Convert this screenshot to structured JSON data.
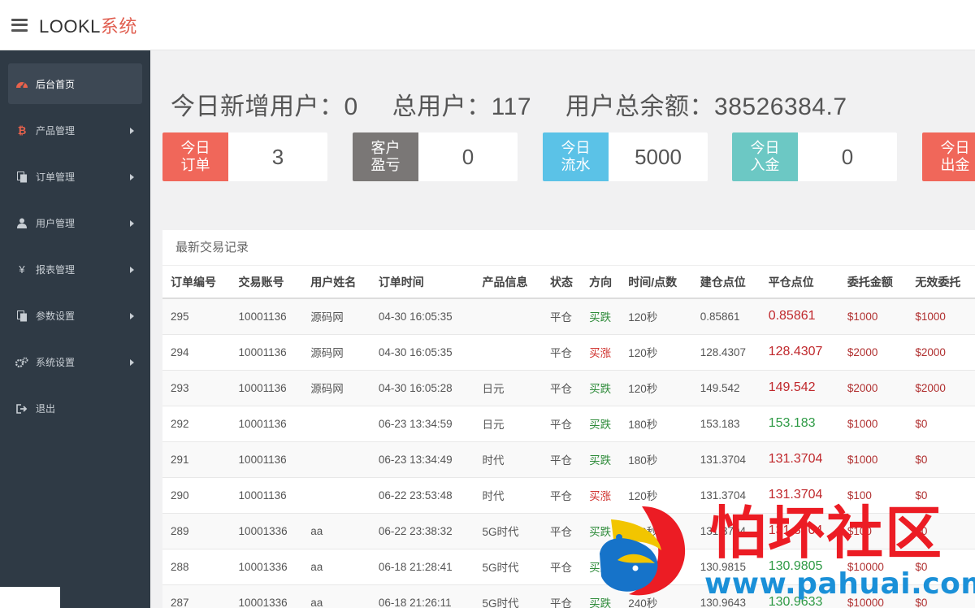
{
  "header": {
    "brand_prefix": "LOOKL",
    "brand_suffix": "系统"
  },
  "sidebar": {
    "items": [
      {
        "label": "后台首页",
        "icon": "dashboard-icon"
      },
      {
        "label": "产品管理",
        "icon": "bitcoin-icon"
      },
      {
        "label": "订单管理",
        "icon": "copy-icon"
      },
      {
        "label": "用户管理",
        "icon": "user-icon"
      },
      {
        "label": "报表管理",
        "icon": "yen-icon"
      },
      {
        "label": "参数设置",
        "icon": "copy-icon"
      },
      {
        "label": "系统设置",
        "icon": "gears-icon"
      },
      {
        "label": "退出",
        "icon": "sign-out-icon"
      }
    ]
  },
  "stats": {
    "new_users": "今日新增用户：0",
    "total_users": "总用户：117",
    "total_balance": "用户总余额：38526384.7"
  },
  "cards": [
    {
      "l1": "今日",
      "l2": "订单",
      "value": "3",
      "color": "#f0675a"
    },
    {
      "l1": "客户",
      "l2": "盈亏",
      "value": "0",
      "color": "#7a7776"
    },
    {
      "l1": "今日",
      "l2": "流水",
      "value": "5000",
      "color": "#5bc2e7"
    },
    {
      "l1": "今日",
      "l2": "入金",
      "value": "0",
      "color": "#6cc8c4"
    },
    {
      "l1": "今日",
      "l2": "出金",
      "value": "",
      "color": "#f0675a"
    }
  ],
  "table": {
    "title": "最新交易记录",
    "headers": [
      "订单编号",
      "交易账号",
      "用户姓名",
      "订单时间",
      "产品信息",
      "状态",
      "方向",
      "时间/点数",
      "建仓点位",
      "平仓点位",
      "委托金额",
      "无效委托"
    ],
    "rows": [
      [
        "295",
        "10001136",
        "源码网",
        "04-30 16:05:35",
        "",
        "平仓",
        "买跌",
        "120秒",
        "0.85861",
        "0.85861",
        "$1000",
        "$1000"
      ],
      [
        "294",
        "10001136",
        "源码网",
        "04-30 16:05:35",
        "",
        "平仓",
        "买涨",
        "120秒",
        "128.4307",
        "128.4307",
        "$2000",
        "$2000"
      ],
      [
        "293",
        "10001136",
        "源码网",
        "04-30 16:05:28",
        "日元",
        "平仓",
        "买跌",
        "120秒",
        "149.542",
        "149.542",
        "$2000",
        "$2000"
      ],
      [
        "292",
        "10001136",
        "",
        "06-23 13:34:59",
        "日元",
        "平仓",
        "买跌",
        "180秒",
        "153.183",
        "153.183",
        "$1000",
        "$0"
      ],
      [
        "291",
        "10001136",
        "",
        "06-23 13:34:49",
        "时代",
        "平仓",
        "买跌",
        "180秒",
        "131.3704",
        "131.3704",
        "$1000",
        "$0"
      ],
      [
        "290",
        "10001136",
        "",
        "06-22 23:53:48",
        "时代",
        "平仓",
        "买涨",
        "120秒",
        "131.3704",
        "131.3704",
        "$100",
        "$0"
      ],
      [
        "289",
        "10001336",
        "aa",
        "06-22 23:38:32",
        "5G时代",
        "平仓",
        "买跌",
        "120秒",
        "131.3704",
        "131.3704",
        "$100",
        "$0"
      ],
      [
        "288",
        "10001336",
        "aa",
        "06-18 21:28:41",
        "5G时代",
        "平仓",
        "买跌",
        "180秒",
        "130.9815",
        "130.9805",
        "$10000",
        "$0"
      ],
      [
        "287",
        "10001336",
        "aa",
        "06-18 21:26:11",
        "5G时代",
        "平仓",
        "买跌",
        "240秒",
        "130.9643",
        "130.9633",
        "$10000",
        "$0"
      ]
    ],
    "close_price_colors": [
      "red",
      "red",
      "red",
      "green",
      "red",
      "red",
      "red",
      "green",
      "green"
    ]
  },
  "watermark": {
    "title": "怕坏社区",
    "url": "www.pahuai.com"
  }
}
